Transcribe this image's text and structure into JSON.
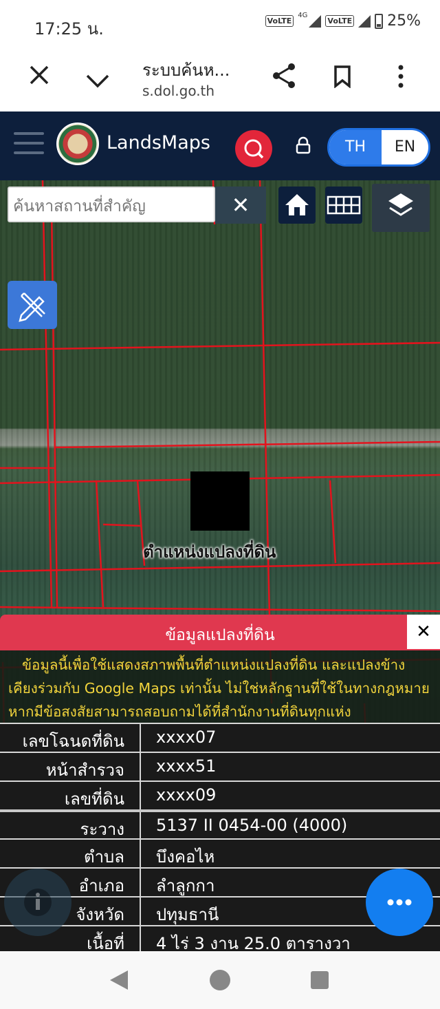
{
  "status": {
    "time": "17:25 น.",
    "volte": "VoLTE",
    "network": "4G",
    "battery": "25%"
  },
  "browser": {
    "title": "ระบบค้นห...",
    "url": "s.dol.go.th"
  },
  "app": {
    "name": "LandsMaps",
    "lang_th": "TH",
    "lang_en": "EN",
    "active_lang": "TH",
    "accent": "#0d1f3c"
  },
  "map": {
    "search_placeholder": "ค้นหาสถานที่สำคัญ",
    "clear_symbol": "✕",
    "parcel_label": "ตำแหน่งแปลงที่ดิน"
  },
  "panel": {
    "title": "ข้อมูลแปลงที่ดิน",
    "close_symbol": "✕",
    "disclaimer": "ข้อมูลนี้เพื่อใช้แสดงสภาพพื้นที่ตำแหน่งแปลงที่ดิน และแปลงข้างเคียงร่วมกับ Google Maps เท่านั้น ไม่ใช่หลักฐานที่ใช้ในทางกฎหมาย หากมีข้อสงสัยสามารถสอบถามได้ที่สำนักงานที่ดินทุกแห่ง",
    "rows": [
      {
        "key": "เลขโฉนดที่ดิน",
        "value": "xxxx07"
      },
      {
        "key": "หน้าสำรวจ",
        "value": "xxxx51"
      },
      {
        "key": "เลขที่ดิน",
        "value": "xxxx09"
      },
      {
        "key": "ระวาง",
        "value": "5137 II 0454-00 (4000)"
      },
      {
        "key": "ตำบล",
        "value": "บึงคอไห"
      },
      {
        "key": "อำเภอ",
        "value": "ลำลูกกา"
      },
      {
        "key": "จังหวัด",
        "value": "ปทุมธานี"
      },
      {
        "key": "เนื้อที่",
        "value": "4 ไร่ 3 งาน 25.0 ตารางวา"
      }
    ]
  }
}
